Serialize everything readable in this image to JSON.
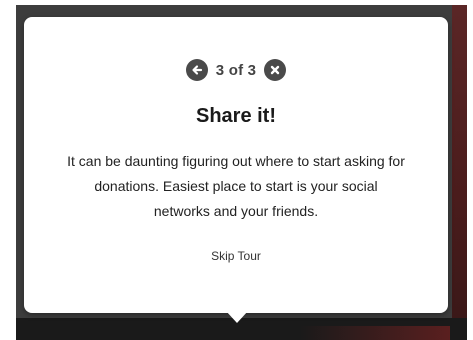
{
  "tour": {
    "step_counter": "3 of 3",
    "title": "Share it!",
    "body": "It can be daunting figuring out where to start asking for donations. Easiest place to start is your social networks and your friends.",
    "skip_label": "Skip Tour",
    "icons": {
      "previous": "arrow-left-icon",
      "close": "close-icon"
    }
  },
  "colors": {
    "overlay": "#3d3d3d",
    "accent": "#5a2626",
    "card": "#ffffff",
    "icon_circle": "#4a4a4a"
  }
}
